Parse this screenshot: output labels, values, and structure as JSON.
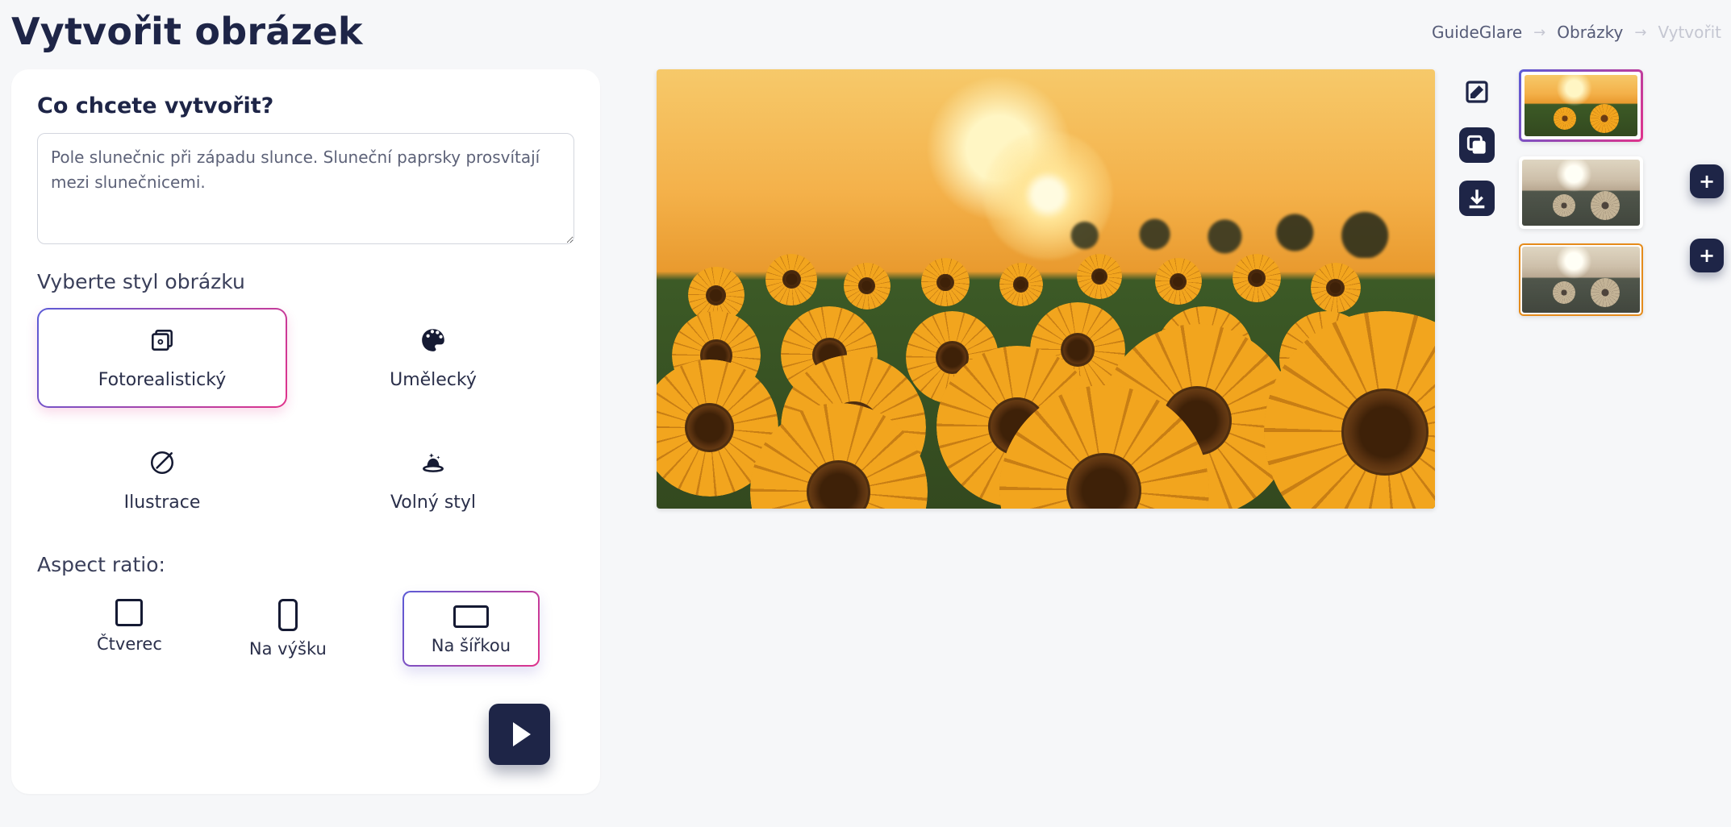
{
  "header": {
    "title": "Vytvořit obrázek",
    "breadcrumb": [
      "GuideGlare",
      "Obrázky",
      "Vytvořit"
    ]
  },
  "prompt": {
    "heading": "Co chcete vytvořit?",
    "value": "Pole slunečnic při západu slunce. Sluneční paprsky prosvítají mezi slunečnicemi."
  },
  "style": {
    "heading": "Vyberte styl obrázku",
    "options": [
      {
        "id": "photorealistic",
        "label": "Fotorealistický",
        "icon": "image-stack-icon",
        "selected": true
      },
      {
        "id": "artistic",
        "label": "Umělecký",
        "icon": "palette-icon",
        "selected": false
      },
      {
        "id": "illustration",
        "label": "Ilustrace",
        "icon": "pencil-circle-icon",
        "selected": false
      },
      {
        "id": "freestyle",
        "label": "Volný styl",
        "icon": "magic-hat-icon",
        "selected": false
      }
    ]
  },
  "aspect": {
    "heading": "Aspect ratio:",
    "options": [
      {
        "id": "square",
        "label": "Čtverec",
        "selected": false
      },
      {
        "id": "portrait",
        "label": "Na výšku",
        "selected": false
      },
      {
        "id": "landscape",
        "label": "Na šířkou",
        "selected": true
      }
    ]
  },
  "actions": {
    "edit": "edit-icon",
    "copy": "copy-icon",
    "download": "download-icon",
    "add": "plus-icon",
    "run": "play-icon"
  },
  "thumbnails": [
    {
      "id": 0,
      "selected": true,
      "variant": "color"
    },
    {
      "id": 1,
      "selected": false,
      "variant": "desaturated"
    },
    {
      "id": 2,
      "selected": false,
      "variant": "warm-border"
    }
  ]
}
